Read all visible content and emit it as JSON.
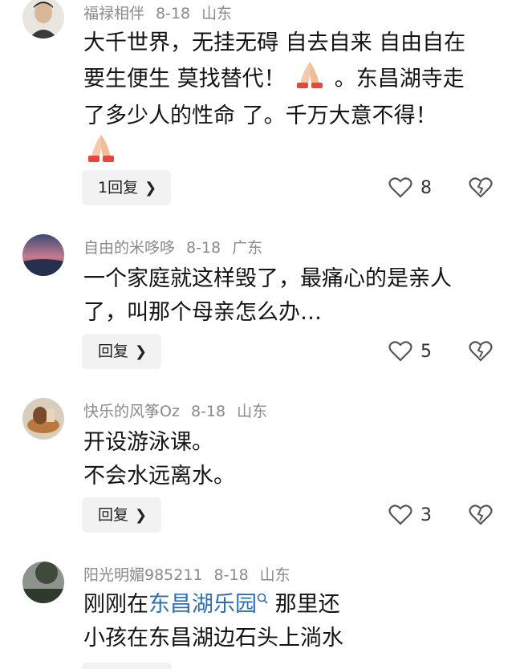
{
  "comments": [
    {
      "username": "福禄相伴",
      "date": "8-18",
      "location": "山东",
      "lines": [
        "大千世界，无挂无碍 自去自来 自由自在",
        "要生便生 莫找替代！",
        "。东昌湖寺走",
        "了多少人的性命 了。千万大意不得！"
      ],
      "reply_label": "1回复",
      "likes": "8"
    },
    {
      "username": "自由的米哆哆",
      "date": "8-18",
      "location": "广东",
      "lines": [
        "一个家庭就这样毁了，最痛心的是亲人",
        "了，叫那个母亲怎么办…"
      ],
      "reply_label": "回复",
      "likes": "5"
    },
    {
      "username": "快乐的风筝Oz",
      "date": "8-18",
      "location": "山东",
      "lines": [
        "开设游泳课。",
        "不会水远离水。"
      ],
      "reply_label": "回复",
      "likes": "3"
    },
    {
      "username": "阳光明媚985211",
      "date": "8-18",
      "location": "山东",
      "line1_prefix": "刚刚在",
      "line1_link": "东昌湖乐园",
      "line1_suffix": " 那里还",
      "line2": "小孩在东昌湖边石头上淌水"
    }
  ],
  "icons": {
    "reply_chevron": "chevron-right-icon",
    "like": "heart-outline-icon",
    "dislike": "broken-heart-icon",
    "search": "search-icon",
    "emoji": "praying-hands-emoji"
  },
  "colors": {
    "link": "#2d6fb3",
    "meta": "#8a8a8a",
    "reply_bg": "#f2f2f2"
  }
}
